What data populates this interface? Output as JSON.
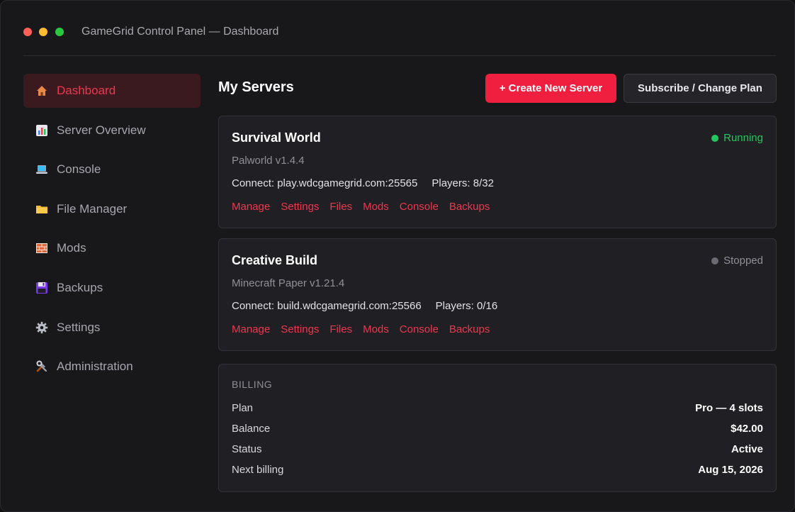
{
  "window": {
    "title": "GameGrid Control Panel — Dashboard"
  },
  "sidebar": {
    "items": [
      {
        "label": "Dashboard",
        "icon": "house-icon",
        "active": true
      },
      {
        "label": "Server Overview",
        "icon": "bar-chart-icon",
        "active": false
      },
      {
        "label": "Console",
        "icon": "laptop-icon",
        "active": false
      },
      {
        "label": "File Manager",
        "icon": "folder-icon",
        "active": false
      },
      {
        "label": "Mods",
        "icon": "brick-icon",
        "active": false
      },
      {
        "label": "Backups",
        "icon": "floppy-disk-icon",
        "active": false
      },
      {
        "label": "Settings",
        "icon": "gear-icon",
        "active": false
      },
      {
        "label": "Administration",
        "icon": "tools-icon",
        "active": false
      }
    ]
  },
  "main": {
    "title": "My Servers",
    "create_button": "+ Create New Server",
    "subscribe_button": "Subscribe / Change Plan"
  },
  "servers": [
    {
      "name": "Survival World",
      "game": "Palworld v1.4.4",
      "connect": "Connect: play.wdcgamegrid.com:25565",
      "players": "Players: 8/32",
      "status": "Running",
      "status_color": "#22c55e",
      "actions": [
        "Manage",
        "Settings",
        "Files",
        "Mods",
        "Console",
        "Backups"
      ]
    },
    {
      "name": "Creative Build",
      "game": "Minecraft Paper v1.21.4",
      "connect": "Connect: build.wdcgamegrid.com:25566",
      "players": "Players: 0/16",
      "status": "Stopped",
      "status_color": "#6b6b73",
      "actions": [
        "Manage",
        "Settings",
        "Files",
        "Mods",
        "Console",
        "Backups"
      ]
    }
  ],
  "billing": {
    "title": "BILLING",
    "rows": [
      {
        "key": "Plan",
        "value": "Pro — 4 slots"
      },
      {
        "key": "Balance",
        "value": "$42.00"
      },
      {
        "key": "Status",
        "value": "Active"
      },
      {
        "key": "Next billing",
        "value": "Aug 15, 2026"
      }
    ]
  },
  "colors": {
    "accent": "#f01f3f",
    "link": "#f0354f",
    "running": "#22c55e",
    "stopped": "#6b6b73"
  }
}
